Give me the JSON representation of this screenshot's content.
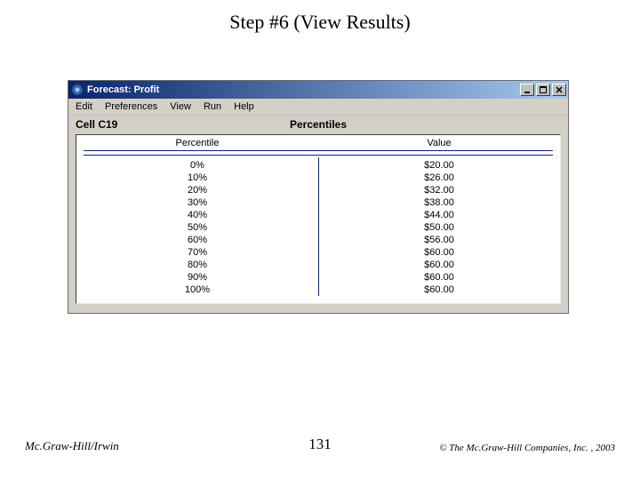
{
  "slide": {
    "title": "Step #6 (View Results)",
    "page_number": "131",
    "footer_left": "Mc.Graw-Hill/Irwin",
    "footer_right": "© The Mc.Graw-Hill Companies, Inc. , 2003"
  },
  "window": {
    "title": "Forecast: Profit",
    "icon_name": "forecast-app-icon",
    "buttons": {
      "minimize": "minimize",
      "maximize": "maximize",
      "close": "close"
    },
    "menubar": [
      "Edit",
      "Preferences",
      "View",
      "Run",
      "Help"
    ],
    "header": {
      "cell_ref": "Cell C19",
      "stat_name": "Percentiles"
    },
    "columns": {
      "left": "Percentile",
      "right": "Value"
    },
    "rows": [
      {
        "pct": "0%",
        "val": "$20.00"
      },
      {
        "pct": "10%",
        "val": "$26.00"
      },
      {
        "pct": "20%",
        "val": "$32.00"
      },
      {
        "pct": "30%",
        "val": "$38.00"
      },
      {
        "pct": "40%",
        "val": "$44.00"
      },
      {
        "pct": "50%",
        "val": "$50.00"
      },
      {
        "pct": "60%",
        "val": "$56.00"
      },
      {
        "pct": "70%",
        "val": "$60.00"
      },
      {
        "pct": "80%",
        "val": "$60.00"
      },
      {
        "pct": "90%",
        "val": "$60.00"
      },
      {
        "pct": "100%",
        "val": "$60.00"
      }
    ]
  },
  "chart_data": {
    "type": "table",
    "title": "Percentiles — Cell C19 (Profit)",
    "columns": [
      "Percentile",
      "Value"
    ],
    "series": [
      {
        "name": "Value ($)",
        "values": [
          20.0,
          26.0,
          32.0,
          38.0,
          44.0,
          50.0,
          56.0,
          60.0,
          60.0,
          60.0,
          60.0
        ]
      }
    ],
    "categories": [
      "0%",
      "10%",
      "20%",
      "30%",
      "40%",
      "50%",
      "60%",
      "70%",
      "80%",
      "90%",
      "100%"
    ]
  }
}
